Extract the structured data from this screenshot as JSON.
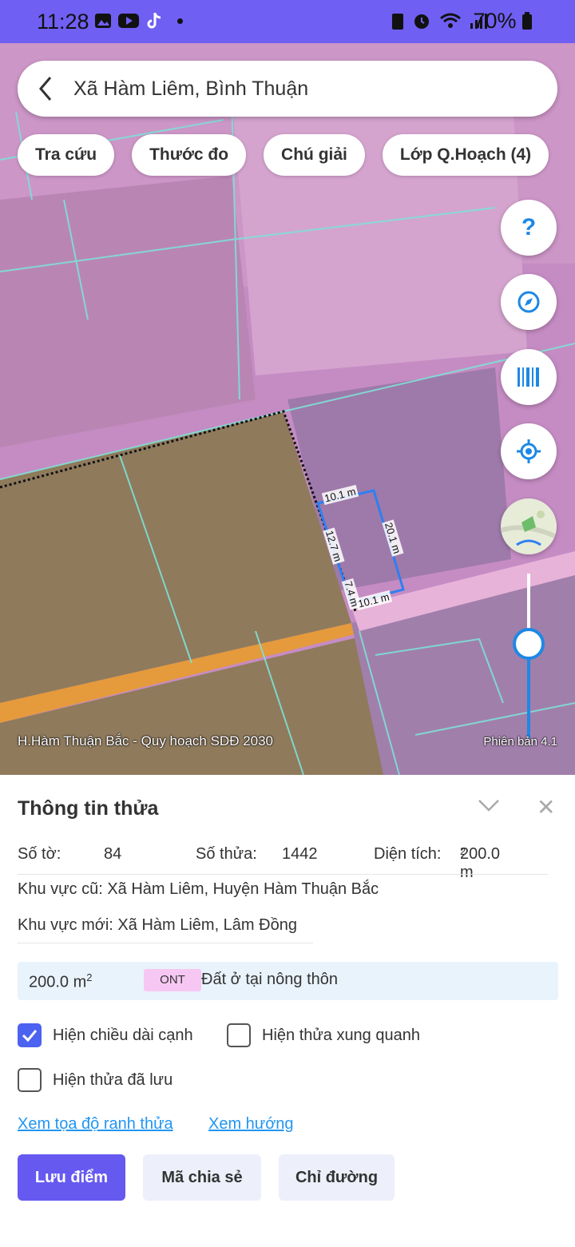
{
  "status_bar": {
    "time": "11:28",
    "battery": "70%"
  },
  "search": {
    "title": "Xã Hàm Liêm, Bình Thuận"
  },
  "chips": [
    "Tra cứu",
    "Thước đo",
    "Chú giải",
    "Lớp Q.Hoạch (4)"
  ],
  "fab": {
    "help": "?"
  },
  "map": {
    "caption": "H.Hàm Thuận Bắc - Quy hoạch SDĐ 2030",
    "version": "Phiên bản 4.1",
    "edges": {
      "top": "10.1 m",
      "right": "20.1 m",
      "left": "12.7 m",
      "bottom_left": "7.4 m",
      "bottom": "10.1 m"
    }
  },
  "panel": {
    "title": "Thông tin thửa",
    "so_to_label": "Số tờ:",
    "so_to": "84",
    "so_thua_label": "Số thửa:",
    "so_thua": "1442",
    "dien_tich_label": "Diện tích:",
    "dien_tich": "200.0 m",
    "unit_sup": "2",
    "khu_vuc_cu": "Khu vực cũ: Xã Hàm Liêm, Huyện Hàm Thuận Bắc",
    "khu_vuc_moi": "Khu vực mới: Xã Hàm Liêm, Lâm Đồng",
    "land": {
      "area": "200.0 m",
      "code": "ONT",
      "desc": "Đất ở tại nông thôn"
    },
    "checks": {
      "edge_length": {
        "label": "Hiện chiều dài cạnh",
        "checked": true
      },
      "neighbors": {
        "label": "Hiện thửa xung quanh",
        "checked": false
      },
      "saved": {
        "label": "Hiện thửa đã lưu",
        "checked": false
      }
    },
    "links": {
      "coords": "Xem tọa độ ranh thửa",
      "direction": "Xem hướng"
    },
    "buttons": {
      "save": "Lưu điểm",
      "share": "Mã chia sẻ",
      "route": "Chỉ đường"
    }
  }
}
